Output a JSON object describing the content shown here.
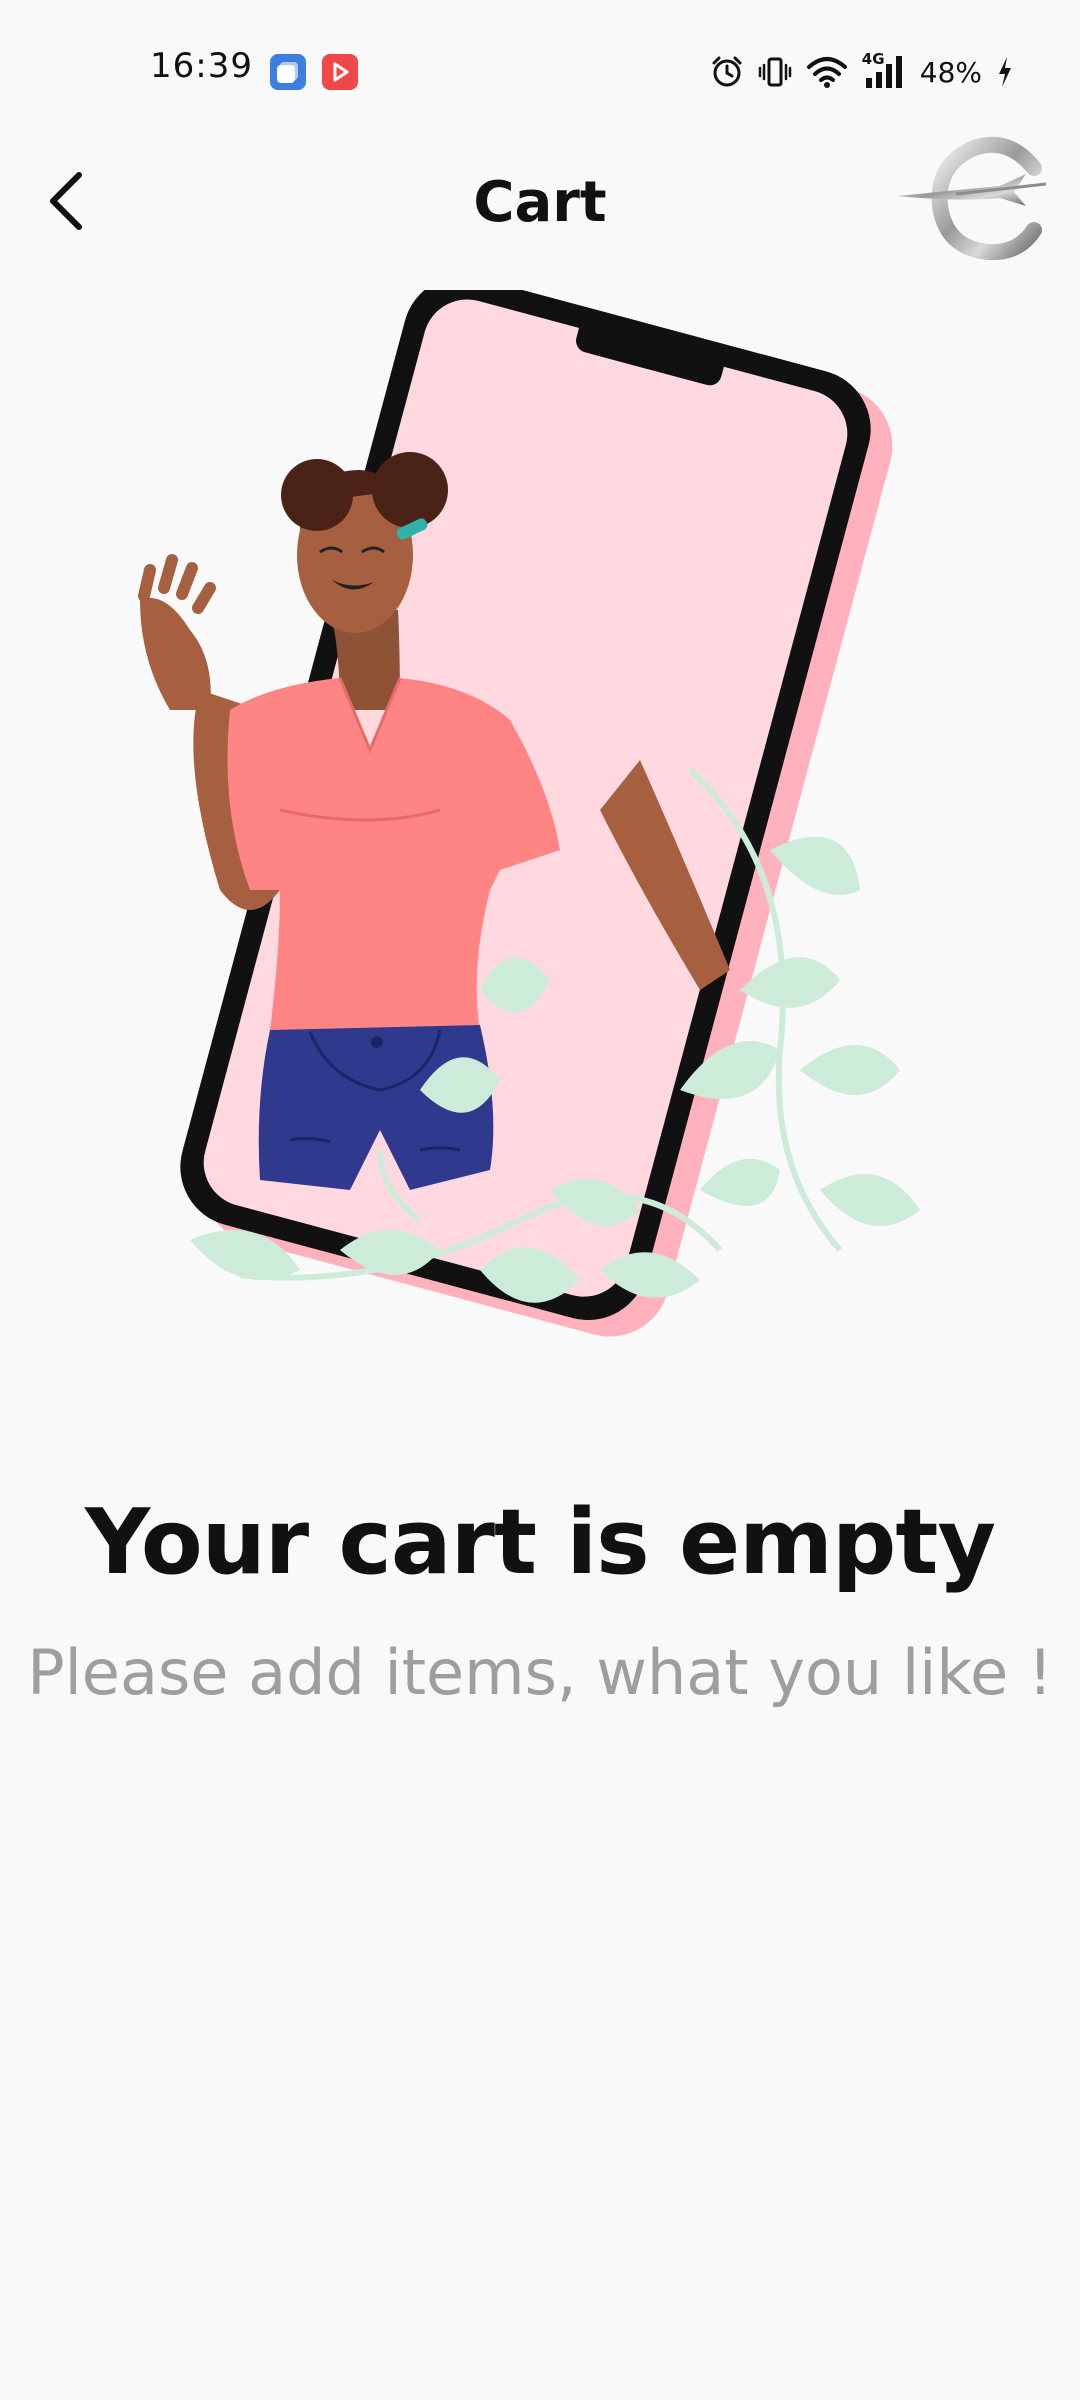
{
  "status_bar": {
    "time": "16:39",
    "battery": "48%",
    "icons": [
      "notification-app-icon",
      "youtube-app-icon",
      "alarm-icon",
      "vibrate-icon",
      "wifi-icon",
      "4g-signal-icon",
      "charging-icon"
    ],
    "network_label": "4G"
  },
  "header": {
    "title": "Cart",
    "back_icon": "chevron-left-icon",
    "logo_icon": "brand-logo"
  },
  "empty_state": {
    "title": "Your cart is empty",
    "subtitle": "Please add items, what you like !"
  },
  "colors": {
    "background": "#f9f9f9",
    "title": "#111111",
    "subtitle": "#9e9e9e",
    "shirt": "#ff8585",
    "jeans": "#2f3a8f",
    "phone_screen": "#ffd9df",
    "leaf": "#cdebd9"
  }
}
